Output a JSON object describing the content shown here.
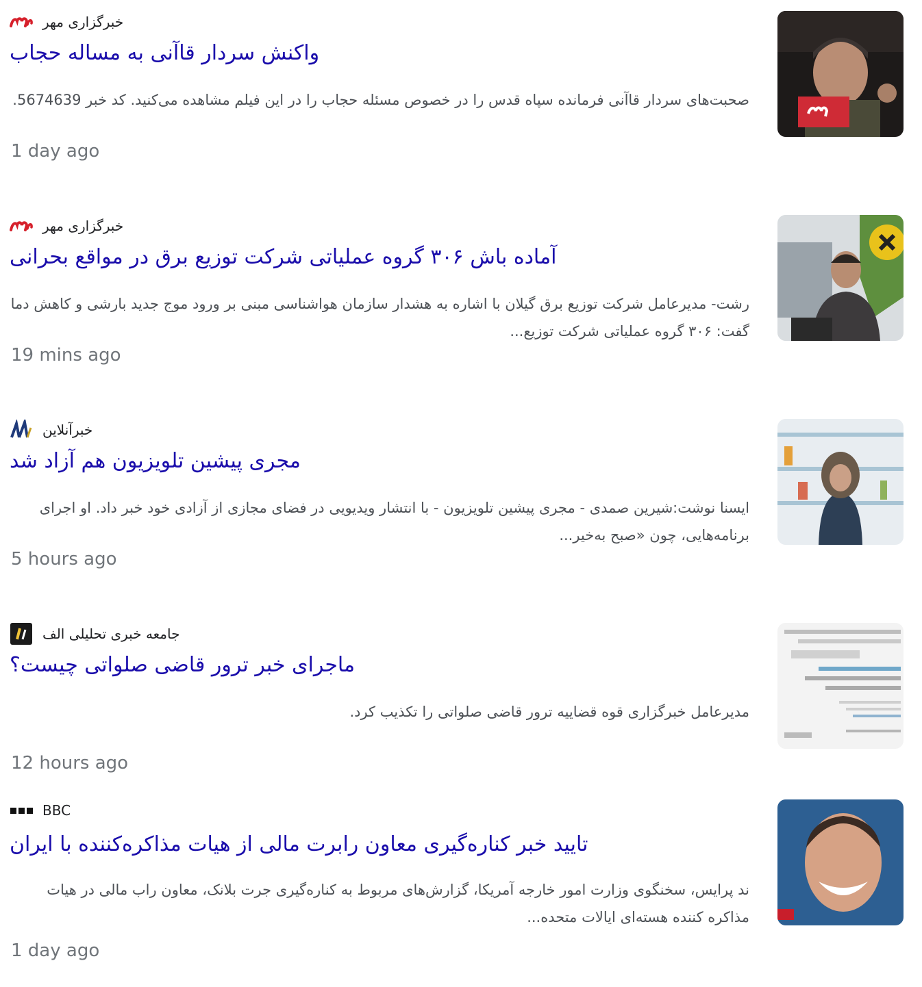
{
  "items": [
    {
      "source": "خبرگزاری مهر",
      "source_icon": "mehr-logo-icon",
      "headline": "واکنش سردار قاآنی به مساله حجاب",
      "snippet": "صحبت‌های سردار قاآنی فرمانده سپاه قدس را در خصوص مسئله حجاب را در این فیلم مشاهده می‌کنید. کد خبر 5674639.",
      "time": "1 day ago"
    },
    {
      "source": "خبرگزاری مهر",
      "source_icon": "mehr-logo-icon",
      "headline": "آماده باش ۳۰۶ گروه عملیاتی شرکت توزیع برق در مواقع بحرانی",
      "snippet": "رشت- مدیرعامل شرکت توزیع برق گیلان با اشاره به هشدار سازمان هواشناسی مبنی بر ورود موج جدید بارشی و کاهش دما گفت: ۳۰۶ گروه عملیاتی شرکت توزیع...",
      "time": "19 mins ago"
    },
    {
      "source": "خبرآنلاین",
      "source_icon": "khabaronline-logo-icon",
      "headline": "مجری پیشین تلویزیون هم آزاد شد",
      "snippet": "ایسنا نوشت:شیرین صمدی - مجری پیشین تلویزیون - با انتشار ویدیویی در فضای مجازی از آزادی خود خبر داد. او اجرای برنامه‌هایی، چون «صبح به‌خیر...",
      "time": "5 hours ago"
    },
    {
      "source": "جامعه خبری تحلیلی الف",
      "source_icon": "alef-logo-icon",
      "headline": "ماجرای خبر ترور قاضی صلواتی چیست؟",
      "snippet": "مدیرعامل خبرگزاری قوه قضاییه ترور قاضی صلواتی را تکذیب کرد.",
      "time": "12 hours ago"
    },
    {
      "source": "BBC",
      "source_icon": "bbc-logo-icon",
      "headline": "تایید خبر کناره‌گیری معاون رابرت مالی از هیات مذاکره‌کننده با ایران",
      "snippet": "ند پرایس، سخنگوی وزارت امور خارجه آمریکا، گزارش‌های مربوط به کناره‌گیری جرت بلانک، معاون راب مالی در هیات مذاکره کننده هسته‌ای ایالات متحده...",
      "time": "1 day ago"
    }
  ],
  "colors": {
    "headline": "#1a0dab",
    "snippet": "#4d5156",
    "timestamp": "#70757a",
    "mehr_red": "#d6202b"
  }
}
